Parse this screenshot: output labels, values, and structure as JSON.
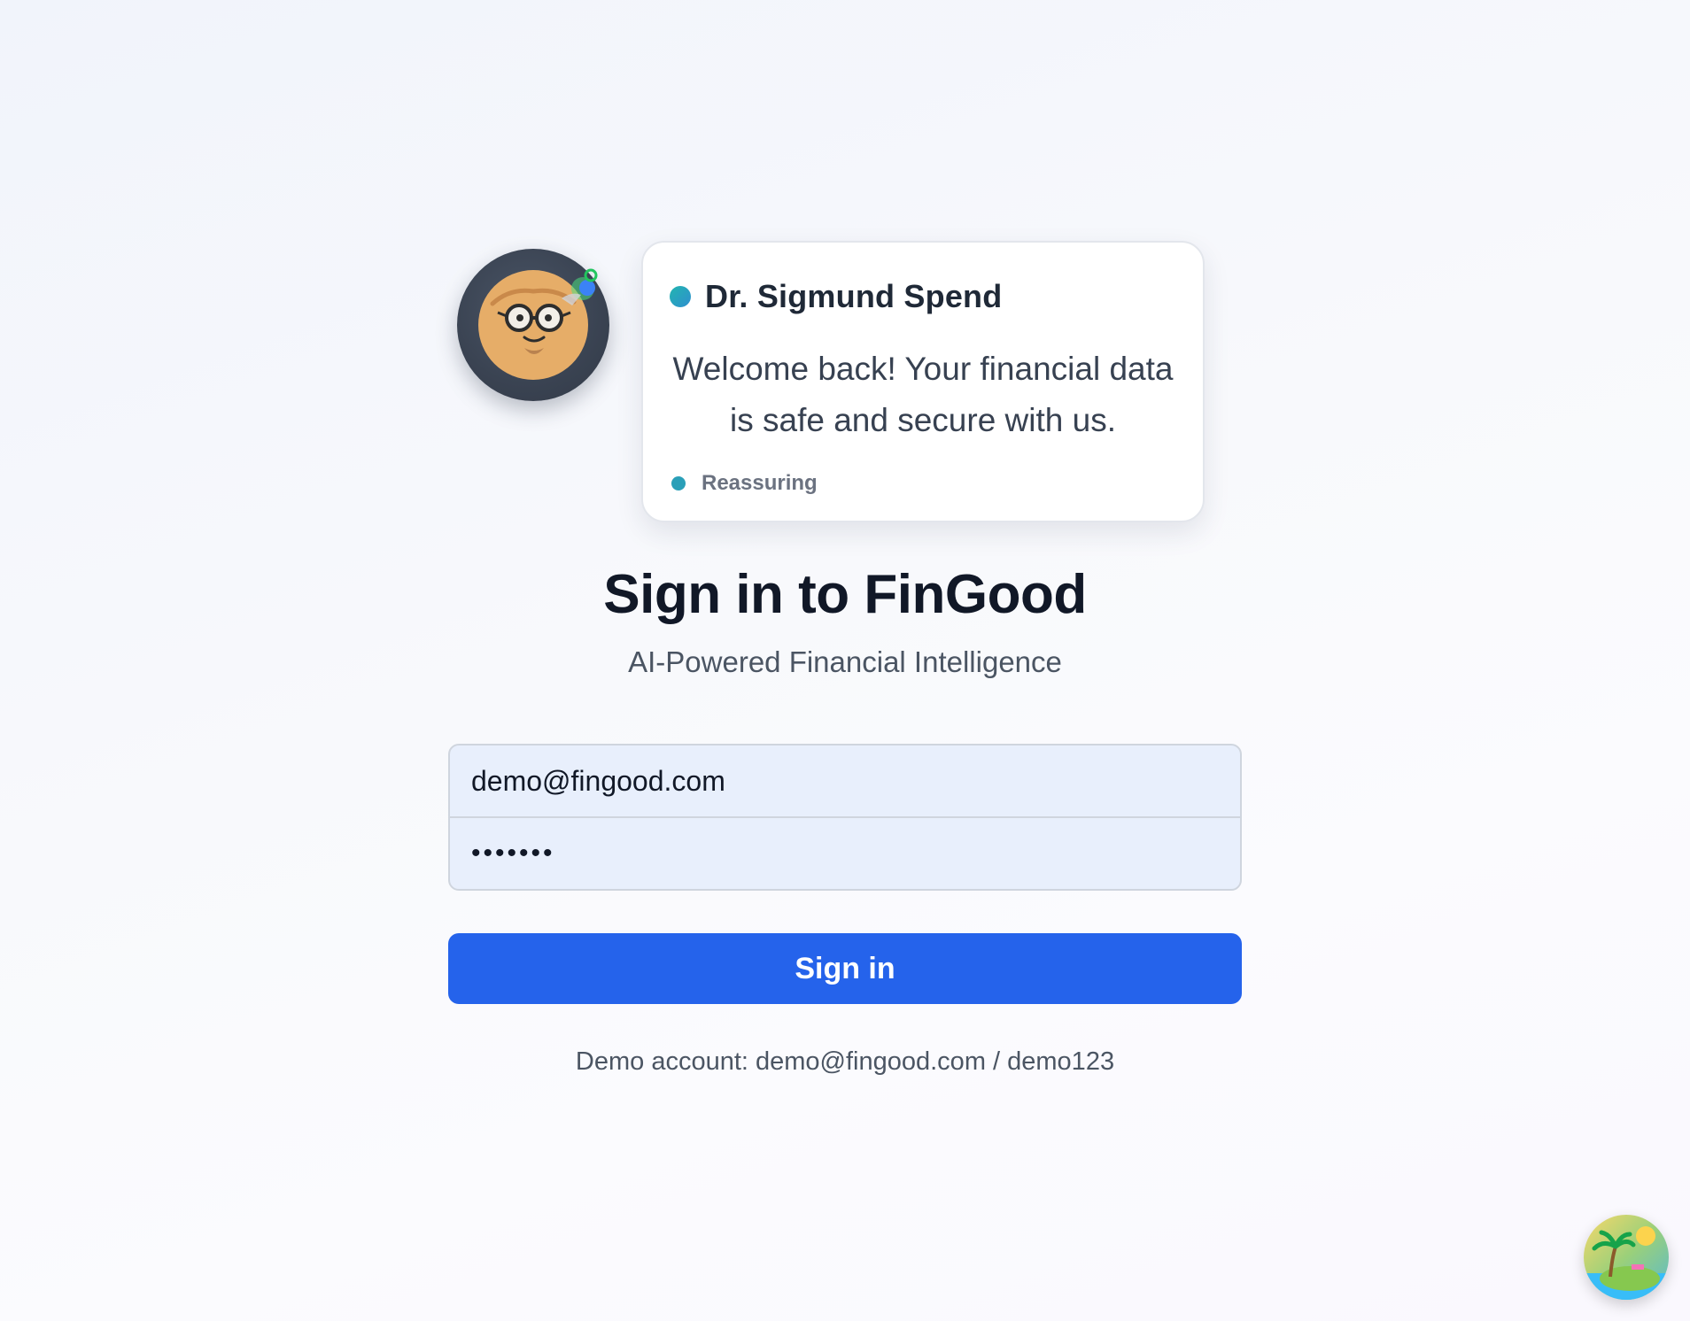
{
  "assistant": {
    "avatar_icon": "professor-avatar-icon",
    "name": "Dr. Sigmund Spend",
    "message": "Welcome back! Your financial data is safe and secure with us.",
    "mood": "Reassuring",
    "status_color": "#22b5b0"
  },
  "page": {
    "title": "Sign in to FinGood",
    "subtitle": "AI-Powered Financial Intelligence"
  },
  "form": {
    "email_value": "demo@fingood.com",
    "password_value": "demo123",
    "submit_label": "Sign in",
    "accent_color": "#2563eb"
  },
  "footer": {
    "demo_note": "Demo account: demo@fingood.com / demo123"
  },
  "theme_toggle": {
    "icon": "tropical-island-icon"
  }
}
